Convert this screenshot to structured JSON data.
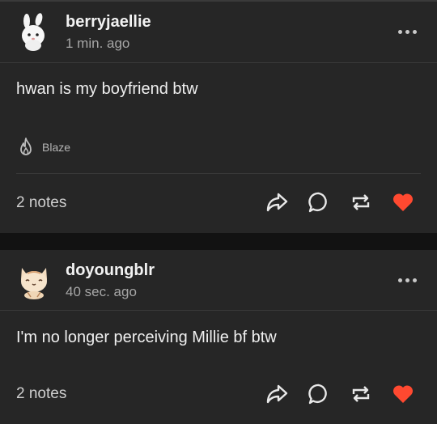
{
  "posts": [
    {
      "username": "berryjaellie",
      "time": "1 min. ago",
      "text": "hwan is my boyfriend btw",
      "blaze_label": "Blaze",
      "notes": "2 notes",
      "avatar_icon": "white-bunny-avatar"
    },
    {
      "username": "doyoungblr",
      "time": "40 sec. ago",
      "text": "I'm no longer perceiving Millie bf btw",
      "notes": "2 notes",
      "avatar_icon": "cat-avatar"
    }
  ],
  "colors": {
    "background": "#121212",
    "card": "#262626",
    "like": "#ff4930",
    "icon": "#e8e8e8"
  },
  "icons": [
    "more-icon",
    "flame-icon",
    "share-icon",
    "reply-icon",
    "reblog-icon",
    "heart-icon"
  ]
}
